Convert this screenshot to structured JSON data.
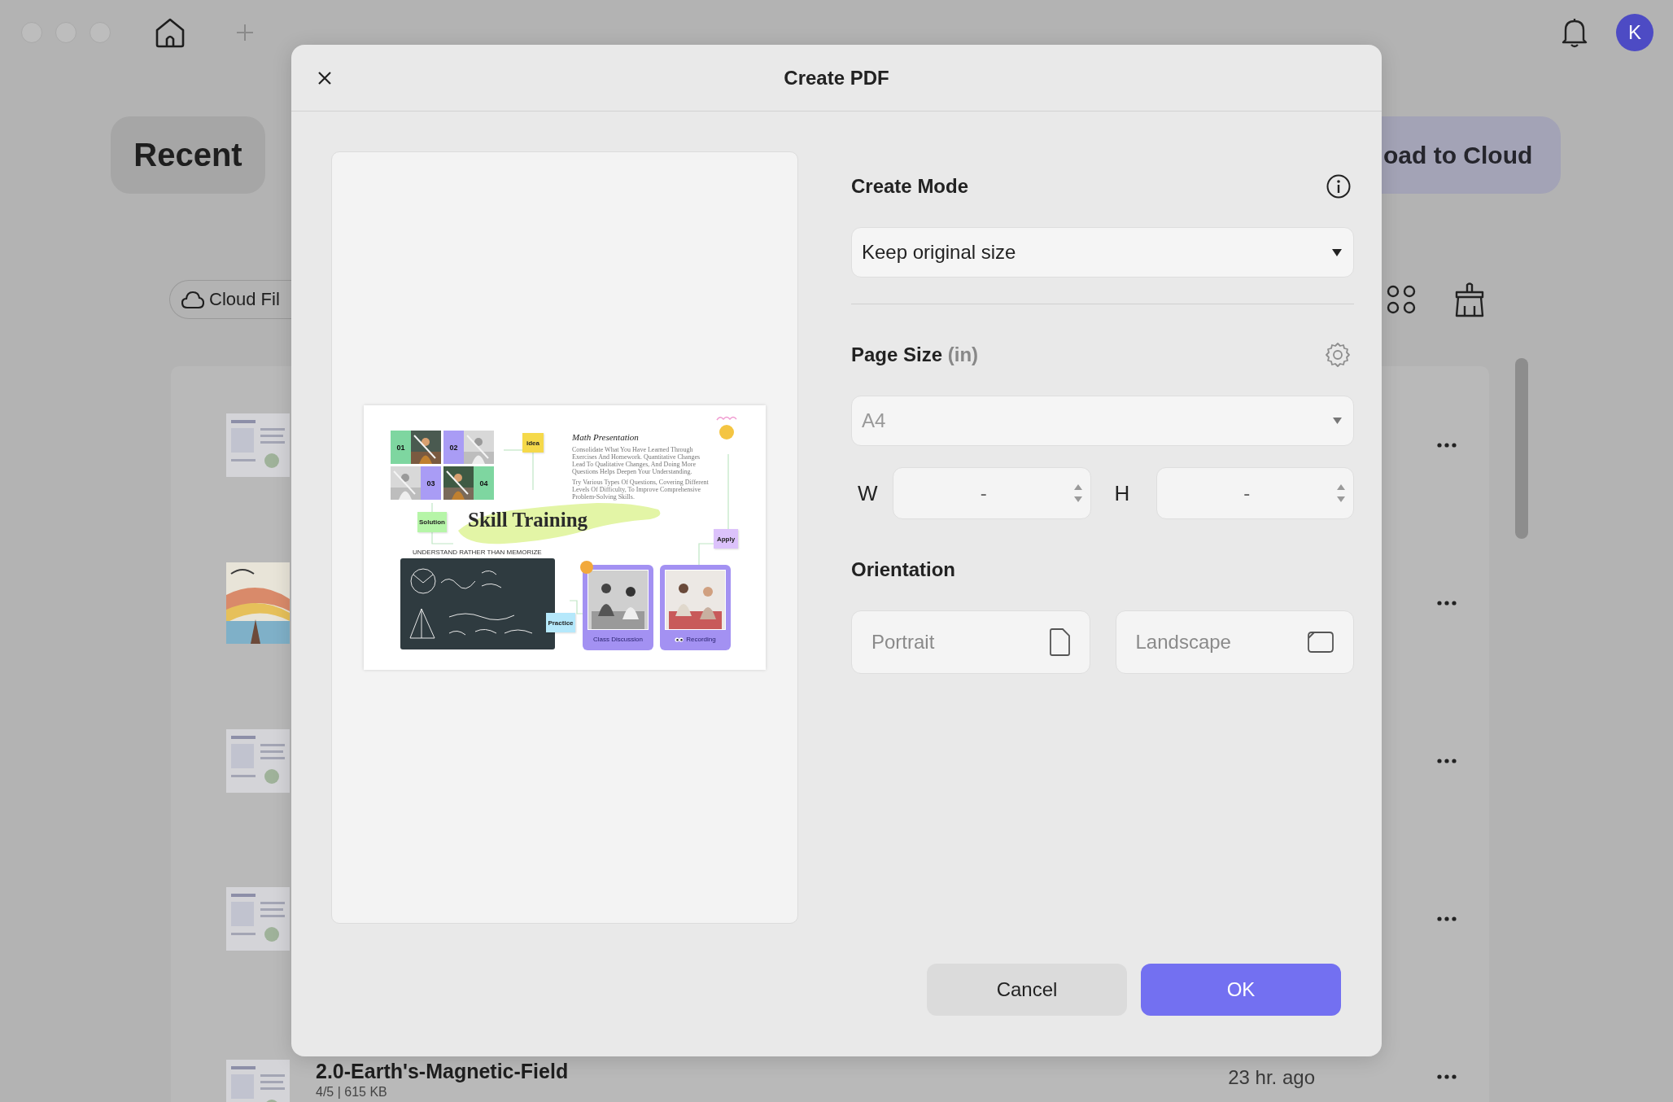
{
  "titlebar": {
    "avatar": "K"
  },
  "recent_button": "Recent",
  "upload_button": "oad to Cloud",
  "cloud_files_button": "Cloud Fil",
  "files": [
    {
      "kind": "document"
    },
    {
      "kind": "travel"
    },
    {
      "kind": "document"
    },
    {
      "kind": "document"
    },
    {
      "kind": "document",
      "name": "2.0-Earth's-Magnetic-Field",
      "meta": "4/5 | 615 KB",
      "time": "23 hr. ago"
    }
  ],
  "dialog": {
    "title": "Create PDF",
    "preview": {
      "tiles": [
        {
          "label": "01",
          "color": "#7ed6a0"
        },
        {
          "label": "02",
          "color": "#a99cf5"
        },
        {
          "label": "03",
          "color": "#a99cf5"
        },
        {
          "label": "04",
          "color": "#7ed6a0"
        }
      ],
      "tags": [
        {
          "label": "idea",
          "color": "#f5d94a"
        },
        {
          "label": "Solution",
          "color": "#b6f5a8"
        },
        {
          "label": "Practice",
          "color": "#b5e8fb"
        },
        {
          "label": "Apply",
          "color": "#dcc2fb"
        }
      ],
      "title": "Math Presentation",
      "paragraphs": [
        "Consolidate What You Have Learned Through Exercises And Homework. Quantitative Changes Lead To Qualitative Changes, And Doing More Questions Helps Deepen Your Understanding.",
        "Try Various Types Of Questions, Covering Different Levels Of Difficulty, To Improve Comprehensive Problem-Solving Skills."
      ],
      "headline": "Skill Training",
      "subtitle": "UNDERSTAND RATHER THAN MEMORIZE",
      "cards": [
        {
          "caption": "Class Discussion"
        },
        {
          "caption": "Recording"
        }
      ]
    },
    "create_mode": {
      "label": "Create Mode",
      "value": "Keep original size"
    },
    "page_size": {
      "label": "Page Size",
      "unit": "(in)",
      "value": "A4",
      "disabled": true
    },
    "width": {
      "label": "W",
      "value": "-"
    },
    "height": {
      "label": "H",
      "value": "-"
    },
    "orientation": {
      "label": "Orientation",
      "options": [
        {
          "label": "Portrait",
          "kind": "portrait",
          "selected": false
        },
        {
          "label": "Landscape",
          "kind": "landscape",
          "selected": false
        }
      ]
    },
    "buttons": [
      {
        "label": "Cancel",
        "kind": "secondary"
      },
      {
        "label": "OK",
        "kind": "primary"
      }
    ]
  }
}
